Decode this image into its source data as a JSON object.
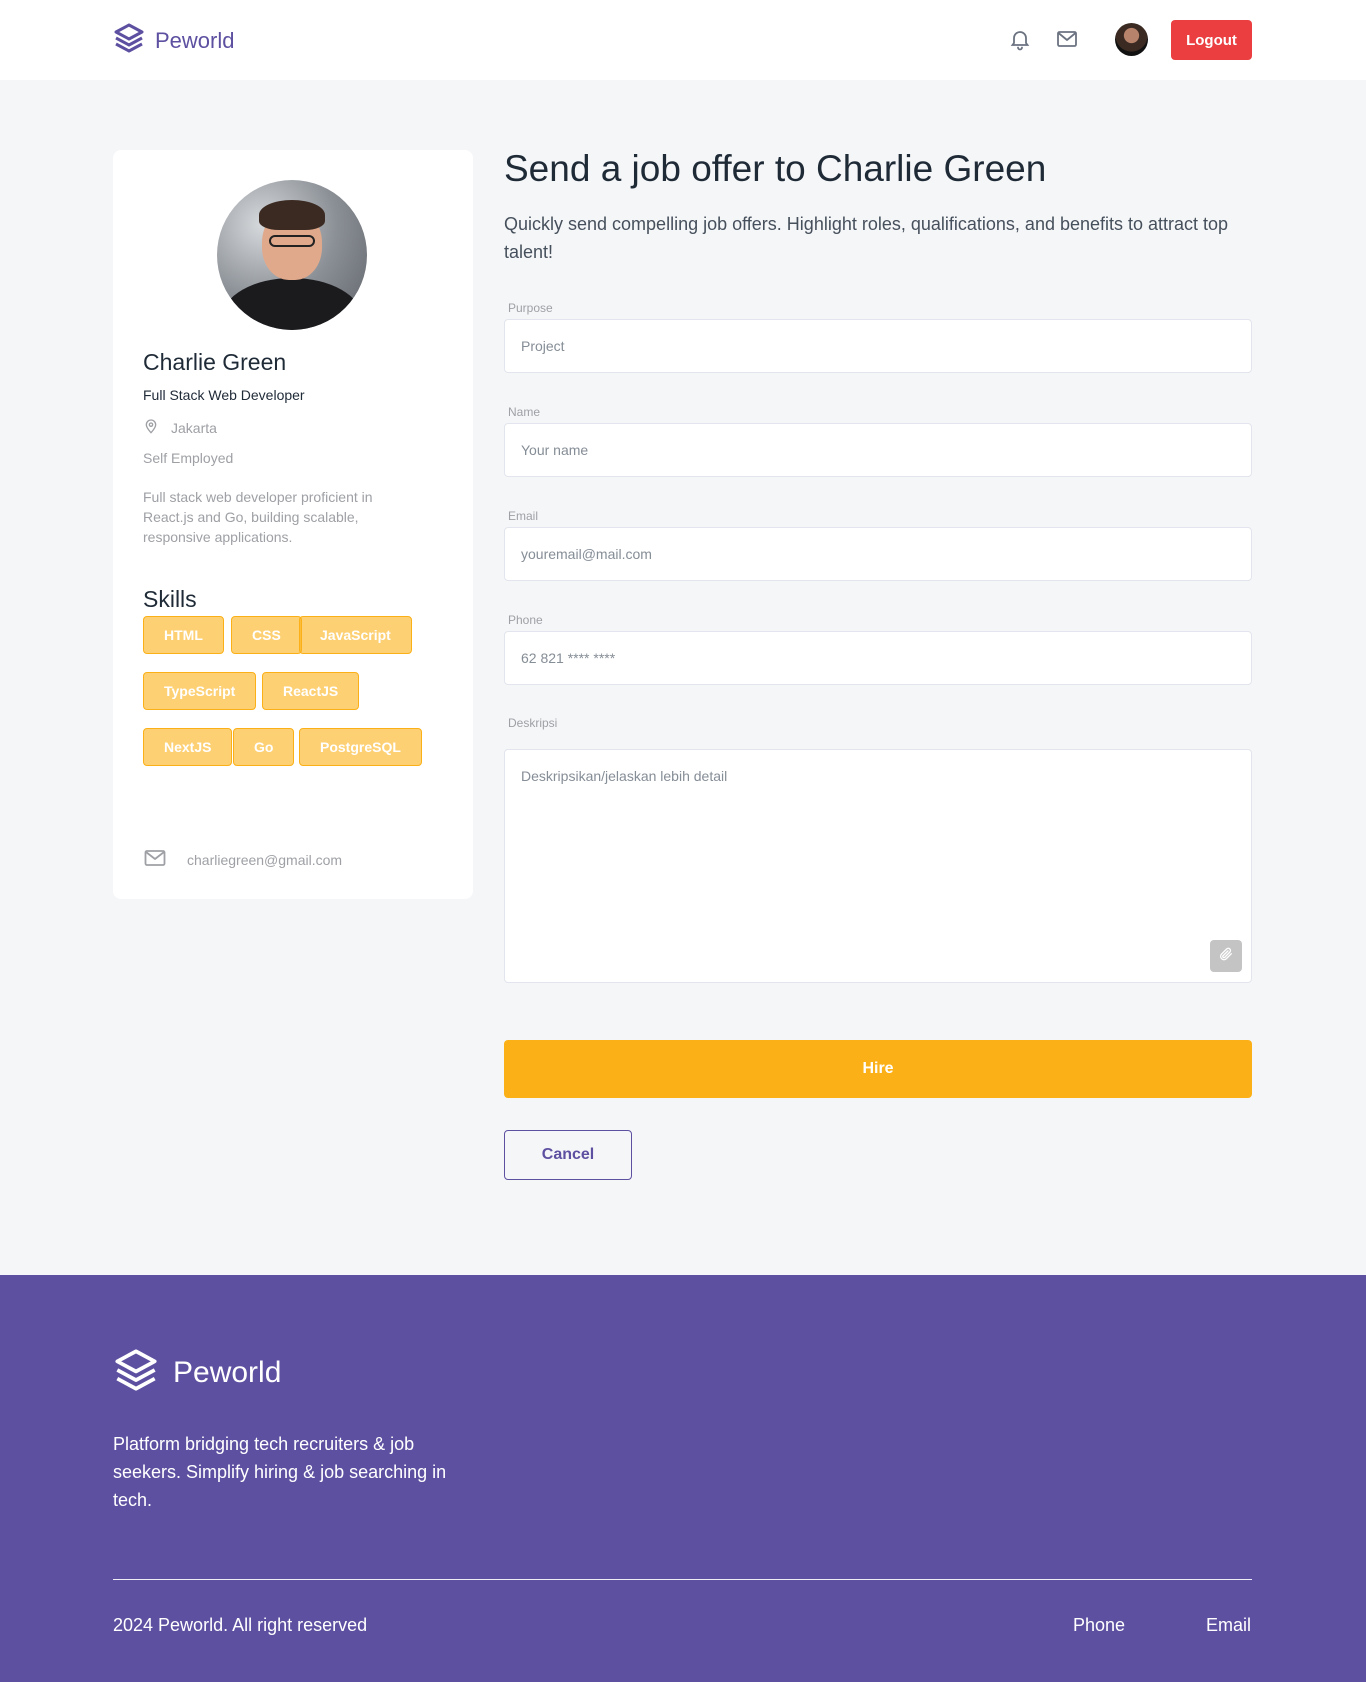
{
  "header": {
    "brand": "Peworld",
    "logout_label": "Logout",
    "icons": [
      "bell-icon",
      "mail-icon"
    ]
  },
  "profile": {
    "name": "Charlie Green",
    "job_title": "Full Stack Web Developer",
    "location": "Jakarta",
    "employment": "Self Employed",
    "bio": "Full stack web developer proficient in React.js and Go, building scalable, responsive applications.",
    "skills_title": "Skills",
    "skills": [
      "HTML",
      "CSS",
      "JavaScript",
      "TypeScript",
      "ReactJS",
      "NextJS",
      "Go",
      "PostgreSQL"
    ],
    "email": "charliegreen@gmail.com"
  },
  "form": {
    "title": "Send a job offer to Charlie Green",
    "subtitle": "Quickly send compelling job offers. Highlight roles, qualifications, and benefits to attract top talent!",
    "purpose_label": "Purpose",
    "purpose_value": "Project",
    "name_label": "Name",
    "name_placeholder": "Your name",
    "email_label": "Email",
    "email_placeholder": "youremail@mail.com",
    "phone_label": "Phone",
    "phone_placeholder": "62 821 **** ****",
    "desc_label": "Deskripsi",
    "desc_placeholder": "Deskripsikan/jelaskan lebih detail",
    "hire_label": "Hire",
    "cancel_label": "Cancel"
  },
  "footer": {
    "brand": "Peworld",
    "description": "Platform bridging tech recruiters & job seekers. Simplify hiring & job searching in tech.",
    "copyright": "2024 Peworld. All right reserved",
    "phone_label": "Phone",
    "email_label": "Email"
  },
  "colors": {
    "brand": "#5e50a1",
    "accent": "#fbb017",
    "danger": "#ea3e41",
    "muted": "#9ea0a5"
  }
}
